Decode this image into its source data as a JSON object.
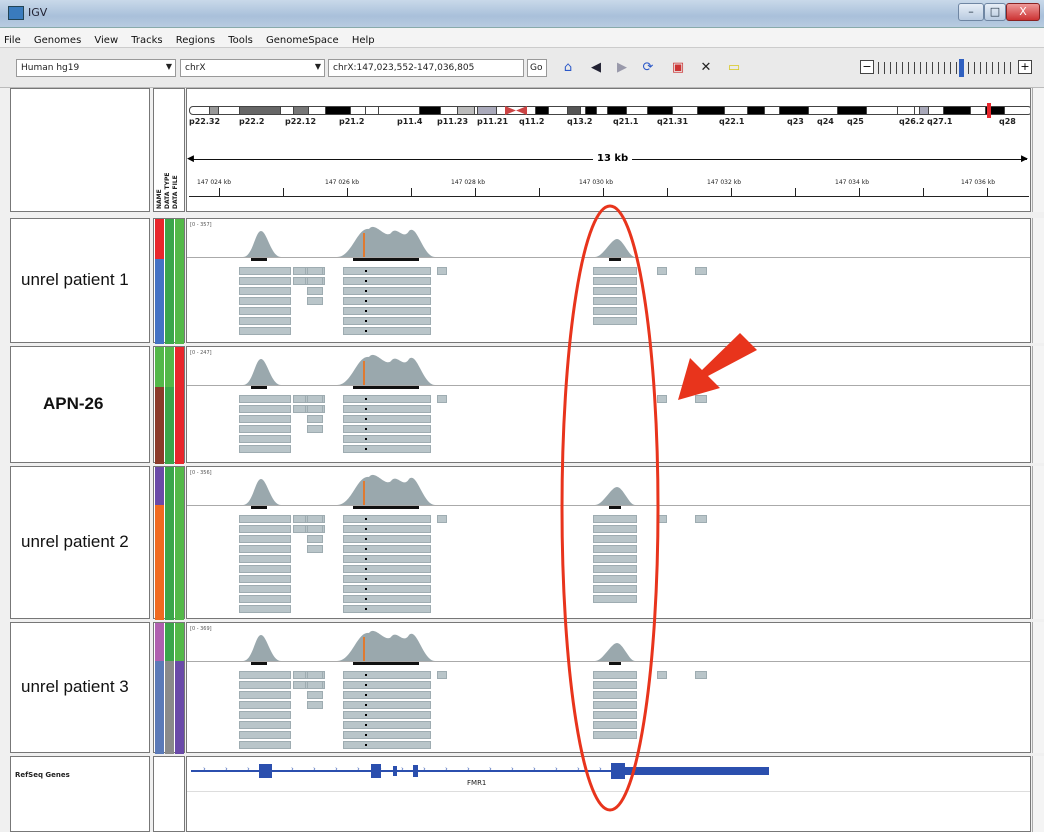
{
  "window": {
    "title": "IGV",
    "minimize": "–",
    "maximize": "□",
    "close": "X"
  },
  "menu": [
    "File",
    "Genomes",
    "View",
    "Tracks",
    "Regions",
    "Tools",
    "GenomeSpace",
    "Help"
  ],
  "toolbar": {
    "genome": "Human hg19",
    "chromosome": "chrX",
    "locus": "chrX:147,023,552-147,036,805",
    "go_label": "Go",
    "icons": [
      "home-icon",
      "back-icon",
      "forward-icon",
      "refresh-icon",
      "roi-icon",
      "resize-icon",
      "popup-text-icon"
    ],
    "zoom_minus": "−",
    "zoom_plus": "+"
  },
  "ideogram": {
    "bands": [
      "p22.32",
      "p22.2",
      "p22.12",
      "p21.2",
      "p11.4",
      "p11.23",
      "p11.21",
      "q11.2",
      "q13.2",
      "q21.1",
      "q21.31",
      "q22.1",
      "q23",
      "q24",
      "q25",
      "q26.2",
      "q27.1",
      "q28"
    ],
    "span_label": "13 kb",
    "ticks": [
      "147 024 kb",
      "147 026 kb",
      "147 028 kb",
      "147 030 kb",
      "147 032 kb",
      "147 034 kb",
      "147 036 kb"
    ]
  },
  "attribute_headers": [
    "NAME",
    "DATA TYPE",
    "DATA FILE"
  ],
  "tracks": [
    {
      "name": "unrel patient 1",
      "range": "[0 - 357]",
      "colors": [
        "#e8262c",
        "#3aa64a",
        "#53b848"
      ],
      "colors2": [
        "#4472c4",
        "#3aa64a",
        "#53b848"
      ]
    },
    {
      "name": "APN-26",
      "range": "[0 - 247]",
      "colors": [
        "#53b848",
        "#53b848",
        "#e8262c"
      ],
      "colors2": [
        "#8b3a2a",
        "#3aa64a",
        "#e8262c"
      ]
    },
    {
      "name": "unrel patient 2",
      "range": "[0 - 356]",
      "colors": [
        "#6a4aa8",
        "#3aa64a",
        "#53b848"
      ],
      "colors2": [
        "#f06a20",
        "#3aa64a",
        "#53b848"
      ]
    },
    {
      "name": "unrel patient 3",
      "range": "[0 - 369]",
      "colors": [
        "#b060b0",
        "#3aa64a",
        "#53b848"
      ],
      "colors2": [
        "#5b7ab8",
        "#8a8a8a",
        "#6a4aa8"
      ]
    }
  ],
  "refseq": {
    "track_name": "RefSeq Genes",
    "gene": "FMR1"
  },
  "colors": {
    "annotation_ellipse": "#e8341c",
    "coverage": "#9aa8ad",
    "read": "#b9c5c9",
    "gene": "#2b4fae"
  }
}
